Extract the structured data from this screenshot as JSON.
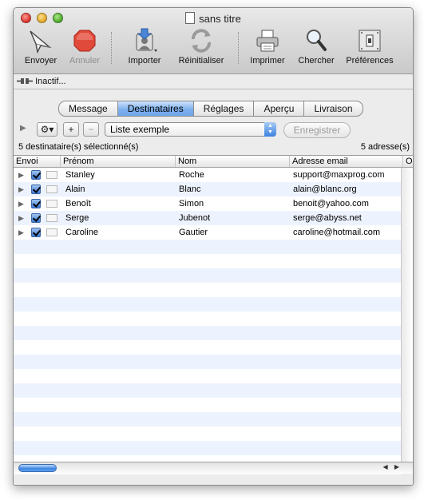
{
  "window": {
    "title": "sans titre"
  },
  "toolbar": {
    "items": [
      {
        "label": "Envoyer",
        "icon": "send-arrow-icon",
        "enabled": true
      },
      {
        "label": "Annuler",
        "icon": "stop-icon",
        "enabled": false
      },
      {
        "label": "Importer",
        "icon": "import-icon",
        "enabled": true
      },
      {
        "label": "Réinitialiser",
        "icon": "reset-icon",
        "enabled": true
      },
      {
        "label": "Imprimer",
        "icon": "printer-icon",
        "enabled": true
      },
      {
        "label": "Chercher",
        "icon": "magnifier-icon",
        "enabled": true
      },
      {
        "label": "Préférences",
        "icon": "preferences-icon",
        "enabled": true
      }
    ]
  },
  "status": {
    "text": "Inactif..."
  },
  "tabs": [
    {
      "label": "Message",
      "active": false
    },
    {
      "label": "Destinataires",
      "active": true
    },
    {
      "label": "Réglages",
      "active": false
    },
    {
      "label": "Aperçu",
      "active": false
    },
    {
      "label": "Livraison",
      "active": false
    }
  ],
  "filter": {
    "add": "+",
    "remove": "−",
    "list_selected": "Liste exemple",
    "save_label": "Enregistrer"
  },
  "counts": {
    "selected": "5 destinataire(s) sélectionné(s)",
    "addresses": "5 adresse(s)"
  },
  "table": {
    "columns": [
      "Envoi",
      "Prénom",
      "Nom",
      "Adresse email",
      "O"
    ],
    "rows": [
      {
        "first": "Stanley",
        "last": "Roche",
        "email": "support@maxprog.com",
        "checked": true
      },
      {
        "first": "Alain",
        "last": "Blanc",
        "email": "alain@blanc.org",
        "checked": true
      },
      {
        "first": "Benoît",
        "last": "Simon",
        "email": "benoit@yahoo.com",
        "checked": true
      },
      {
        "first": "Serge",
        "last": "Jubenot",
        "email": "serge@abyss.net",
        "checked": true
      },
      {
        "first": "Caroline",
        "last": "Gautier",
        "email": "caroline@hotmail.com",
        "checked": true
      }
    ]
  },
  "colors": {
    "accent": "#6fa5ea",
    "row_stripe": "#edf3fe",
    "stop_red": "#e04a3a"
  }
}
